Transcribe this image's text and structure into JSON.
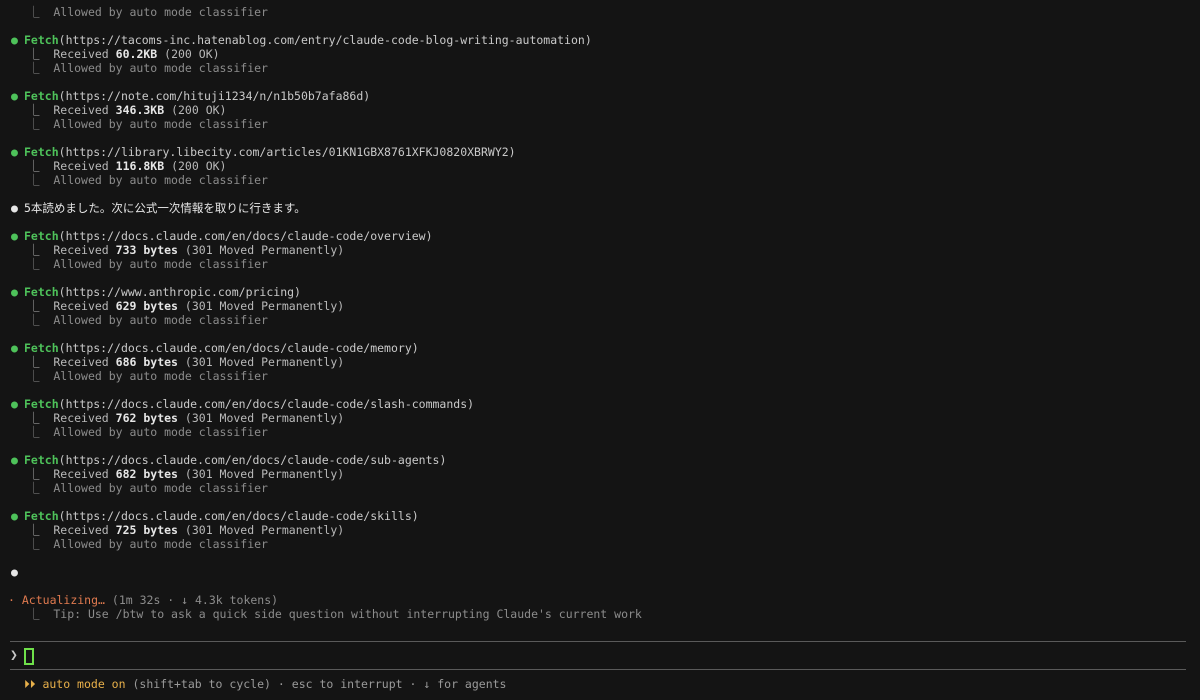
{
  "top_allowed": "⎿  Allowed by auto mode classifier",
  "fetches_a": [
    {
      "tool": "Fetch",
      "url": "https://tacoms-inc.hatenablog.com/entry/claude-code-blog-writing-automation",
      "size": "60.2KB",
      "status": "(200 OK)"
    },
    {
      "tool": "Fetch",
      "url": "https://note.com/hituji1234/n/n1b50b7afa86d",
      "size": "346.3KB",
      "status": "(200 OK)"
    },
    {
      "tool": "Fetch",
      "url": "https://library.libecity.com/articles/01KN1GBX8761XFKJ0820XBRWY2",
      "size": "116.8KB",
      "status": "(200 OK)"
    }
  ],
  "assistant_message": "5本読めました。次に公式一次情報を取りに行きます。",
  "fetches_b": [
    {
      "tool": "Fetch",
      "url": "https://docs.claude.com/en/docs/claude-code/overview",
      "size": "733 bytes",
      "status": "(301 Moved Permanently)"
    },
    {
      "tool": "Fetch",
      "url": "https://www.anthropic.com/pricing",
      "size": "629 bytes",
      "status": "(301 Moved Permanently)"
    },
    {
      "tool": "Fetch",
      "url": "https://docs.claude.com/en/docs/claude-code/memory",
      "size": "686 bytes",
      "status": "(301 Moved Permanently)"
    },
    {
      "tool": "Fetch",
      "url": "https://docs.claude.com/en/docs/claude-code/slash-commands",
      "size": "762 bytes",
      "status": "(301 Moved Permanently)"
    },
    {
      "tool": "Fetch",
      "url": "https://docs.claude.com/en/docs/claude-code/sub-agents",
      "size": "682 bytes",
      "status": "(301 Moved Permanently)"
    },
    {
      "tool": "Fetch",
      "url": "https://docs.claude.com/en/docs/claude-code/skills",
      "size": "725 bytes",
      "status": "(301 Moved Permanently)"
    }
  ],
  "received_prefix": "⎿  Received ",
  "allowed_text": "⎿  Allowed by auto mode classifier",
  "green_bullet": "●",
  "white_bullet": "●",
  "spinner_glyph": "·",
  "actualizing_label": "Actualizing…",
  "actualizing_meta": "(1m 32s · ↓ 4.3k tokens)",
  "tip_text": "⎿  Tip: Use /btw to ask a quick side question without interrupting Claude's current work",
  "prompt_char": "❯",
  "footer": {
    "mode_icon": "⏵⏵",
    "mode_label": "auto mode on",
    "mode_hint": "(shift+tab to cycle)",
    "sep1": "·",
    "interrupt": "esc to interrupt",
    "sep2": "·",
    "agents_icon": "↓",
    "agents": "for agents"
  },
  "colors": {
    "background": "#141414",
    "tool_green": "#4ec25a",
    "actualizing_orange": "#e07a4f",
    "mode_yellow": "#e8b04a",
    "cursor_green": "#6fe04a"
  }
}
